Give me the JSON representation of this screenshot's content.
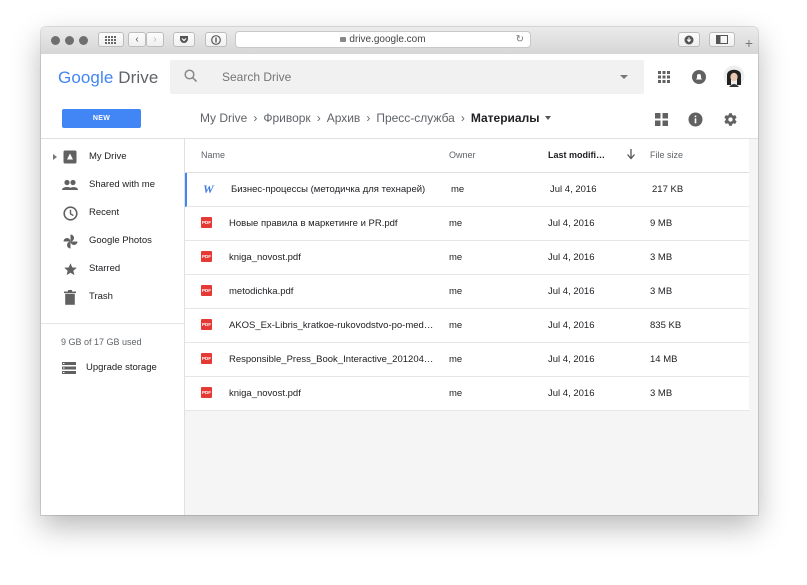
{
  "browser": {
    "url": "drive.google.com",
    "new_tab": "+"
  },
  "app": {
    "logo_google": "Google",
    "logo_drive": " Drive",
    "search_placeholder": "Search Drive"
  },
  "toolbar": {
    "new_label": "NEW"
  },
  "breadcrumb": {
    "items": [
      "My Drive",
      "Фриворк",
      "Архив",
      "Пресс-служба"
    ],
    "current": "Материалы",
    "separator": "›"
  },
  "sidebar": {
    "items": [
      {
        "label": "My Drive",
        "icon": "my-drive-icon"
      },
      {
        "label": "Shared with me",
        "icon": "shared-icon"
      },
      {
        "label": "Recent",
        "icon": "clock-icon"
      },
      {
        "label": "Google Photos",
        "icon": "photos-icon"
      },
      {
        "label": "Starred",
        "icon": "star-icon"
      },
      {
        "label": "Trash",
        "icon": "trash-icon"
      }
    ],
    "storage_text": "9 GB of 17 GB used",
    "upgrade_label": "Upgrade storage"
  },
  "table": {
    "columns": {
      "name": "Name",
      "owner": "Owner",
      "modified": "Last modifi…",
      "size": "File size"
    },
    "rows": [
      {
        "type": "word",
        "name": "Бизнес-процессы (методичка для технарей)",
        "owner": "me",
        "modified": "Jul 4, 2016",
        "size": "217 KB"
      },
      {
        "type": "pdf",
        "name": "Новые правила в маркетинге и PR.pdf",
        "owner": "me",
        "modified": "Jul 4, 2016",
        "size": "9 MB"
      },
      {
        "type": "pdf",
        "name": "kniga_novost.pdf",
        "owner": "me",
        "modified": "Jul 4, 2016",
        "size": "3 MB"
      },
      {
        "type": "pdf",
        "name": "metodichka.pdf",
        "owner": "me",
        "modified": "Jul 4, 2016",
        "size": "3 MB"
      },
      {
        "type": "pdf",
        "name": "AKOS_Ex-Libris_kratkoe-rukovodstvo-po-mediaan…",
        "owner": "me",
        "modified": "Jul 4, 2016",
        "size": "835 KB"
      },
      {
        "type": "pdf",
        "name": "Responsible_Press_Book_Interactive_20120416_…",
        "owner": "me",
        "modified": "Jul 4, 2016",
        "size": "14 MB"
      },
      {
        "type": "pdf",
        "name": "kniga_novost.pdf",
        "owner": "me",
        "modified": "Jul 4, 2016",
        "size": "3 MB"
      }
    ],
    "pdf_badge": "PDF",
    "word_badge": "W"
  },
  "colors": {
    "accent": "#4285f4",
    "pdf": "#e53935"
  }
}
